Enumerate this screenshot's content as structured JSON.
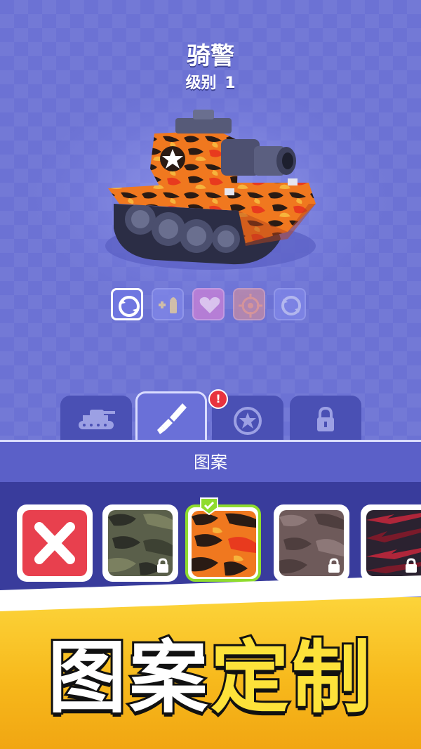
{
  "tank": {
    "name": "骑警",
    "level_label": "级别",
    "level_value": "1"
  },
  "abilities": [
    {
      "icon": "rotate-icon",
      "state": "active"
    },
    {
      "icon": "ammo-plus-icon",
      "state": "inactive"
    },
    {
      "icon": "heart-icon",
      "state": "inactive"
    },
    {
      "icon": "crosshair-icon",
      "state": "inactive"
    },
    {
      "icon": "rotate-icon",
      "state": "inactive"
    }
  ],
  "tabs": [
    {
      "icon": "tank-icon",
      "active": false
    },
    {
      "icon": "paint-brush-icon",
      "active": true,
      "badge": "!"
    },
    {
      "icon": "star-emblem-icon",
      "active": false
    },
    {
      "icon": "lock-icon",
      "active": false
    }
  ],
  "panel": {
    "title": "图案"
  },
  "patterns": [
    {
      "type": "none",
      "locked": false,
      "selected": false
    },
    {
      "type": "green-camo",
      "locked": true,
      "selected": false
    },
    {
      "type": "orange-camo",
      "locked": false,
      "selected": true
    },
    {
      "type": "brown-camo",
      "locked": true,
      "selected": false
    },
    {
      "type": "red-stripe-camo",
      "locked": true,
      "selected": false
    }
  ],
  "banner": {
    "word1": "图案",
    "word2": "定制"
  },
  "colors": {
    "background": "#6c72d4",
    "selected_border": "#8fdc2e",
    "remove_button": "#e8404e",
    "banner": "#f7b91c",
    "badge": "#e8333f"
  }
}
